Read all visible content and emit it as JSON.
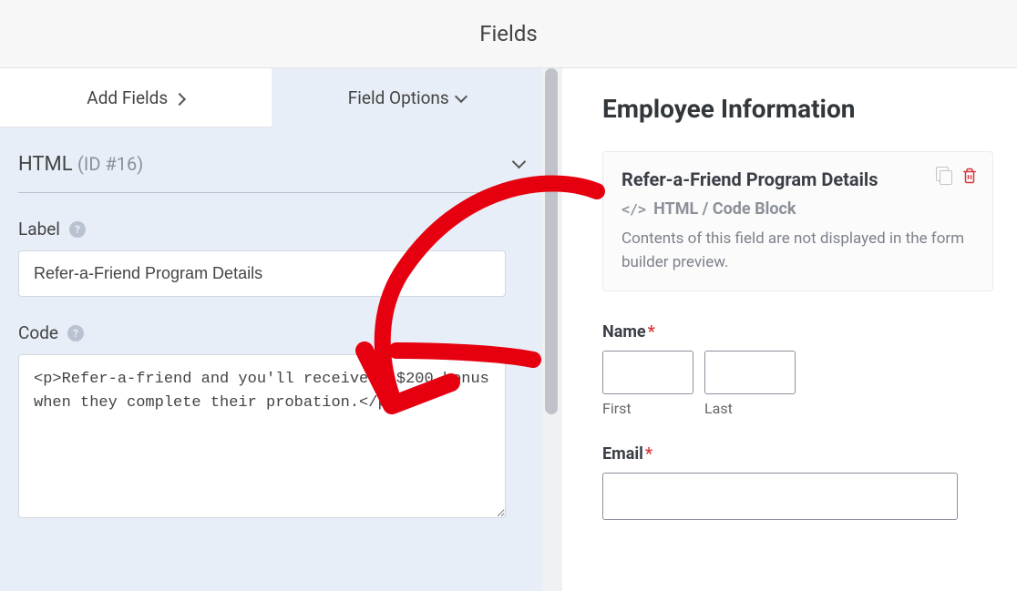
{
  "header": {
    "title": "Fields"
  },
  "tabs": {
    "add": "Add Fields",
    "options": "Field Options"
  },
  "section": {
    "name": "HTML",
    "idLabel": "(ID #16)"
  },
  "labelField": {
    "label": "Label",
    "value": "Refer-a-Friend Program Details"
  },
  "codeField": {
    "label": "Code",
    "value": "<p>Refer-a-friend and you'll receive a $200 bonus when they complete their probation.</p>"
  },
  "preview": {
    "title": "Employee Information",
    "htmlBlock": {
      "title": "Refer-a-Friend Program Details",
      "subtitle": "HTML / Code Block",
      "desc": "Contents of this field are not displayed in the form builder preview."
    },
    "nameLabel": "Name",
    "firstLabel": "First",
    "lastLabel": "Last",
    "emailLabel": "Email",
    "requiredMark": "*"
  }
}
